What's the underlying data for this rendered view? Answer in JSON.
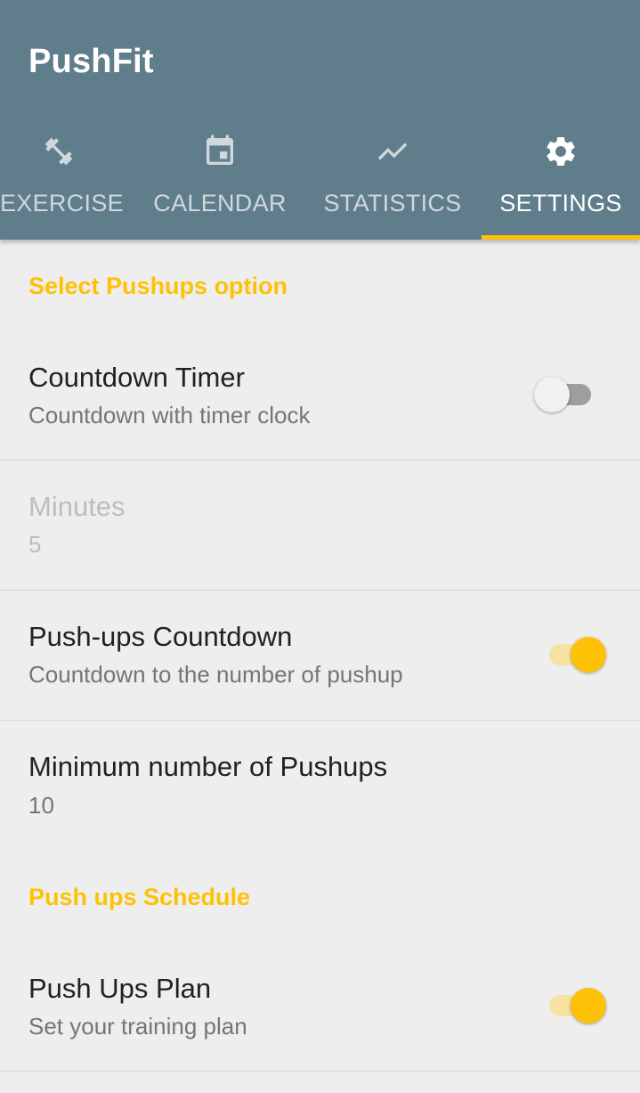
{
  "app": {
    "title": "PushFit"
  },
  "tabs": [
    {
      "label": "EXERCISE",
      "icon": "dumbbell-icon",
      "active": false
    },
    {
      "label": "CALENDAR",
      "icon": "calendar-icon",
      "active": false
    },
    {
      "label": "STATISTICS",
      "icon": "trend-line-icon",
      "active": false
    },
    {
      "label": "SETTINGS",
      "icon": "gear-icon",
      "active": true
    }
  ],
  "colors": {
    "appbar": "#607d8b",
    "accent": "#ffc107",
    "background": "#eeeeee"
  },
  "settings": {
    "pushups_option": {
      "header": "Select Pushups option",
      "countdown_timer": {
        "title": "Countdown Timer",
        "summary": "Countdown with timer clock",
        "enabled": false
      },
      "minutes": {
        "title": "Minutes",
        "value": "5",
        "disabled": true
      },
      "pushups_countdown": {
        "title": "Push-ups Countdown",
        "summary": "Countdown to the number of pushup",
        "enabled": true
      },
      "minimum_pushups": {
        "title": "Minimum number of Pushups",
        "value": "10"
      }
    },
    "schedule": {
      "header": "Push ups Schedule",
      "plan": {
        "title": "Push Ups Plan",
        "summary": "Set your training plan",
        "enabled": true
      }
    }
  }
}
